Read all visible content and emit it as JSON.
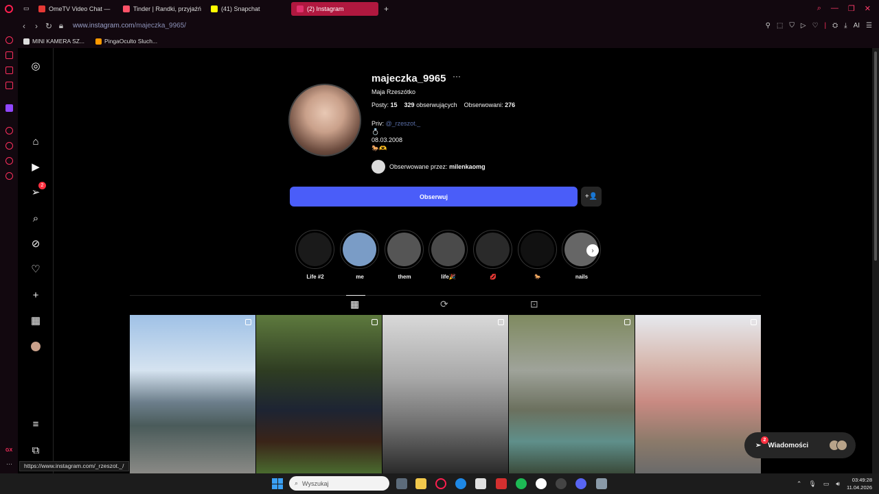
{
  "browser": {
    "tabs": [
      {
        "label": "OmeTV Video Chat —",
        "color": "#e53935"
      },
      {
        "label": "Tinder | Randki, przyjaźń",
        "color": "#fe5268"
      },
      {
        "label": "(41) Snapchat",
        "color": "#fffc00"
      },
      {
        "label": "(2) Instagram",
        "color": "#e1306c"
      }
    ],
    "new_tab": "+",
    "url_host": "www.instagram.com",
    "url_path": "/majeczka_9965/",
    "ai_label": "AI",
    "bookmarks": [
      "MINI KAMERA SZ...",
      "PingaOculto Sluch..."
    ],
    "status_link": "https://www.instagram.com/_rzeszot._/",
    "opera_gx_label": "GX",
    "accent": "#ff1f4f"
  },
  "nav": {
    "messages_badge": "2"
  },
  "profile": {
    "username": "majeczka_9965",
    "more": "···",
    "full_name": "Maja Rzeszótko",
    "stats": {
      "posts_label": "Posty:",
      "posts": "15",
      "followers": "329",
      "followers_label": "obserwujących",
      "following_label": "Obserwowani:",
      "following": "276"
    },
    "bio_prefix": "Priv:",
    "bio_tag": "@_rzeszot._",
    "bio_line2": "💍",
    "bio_line3": "08.03.2008",
    "bio_line4": "🐎🫶",
    "followed_by_prefix": "Obserwowane przez:",
    "followed_by_user": "milenkaomg",
    "follow_button": "Obserwuj",
    "suggest_icon": "+👤"
  },
  "highlights": [
    {
      "label": "Life #2",
      "color": "#1a1a1a"
    },
    {
      "label": "me",
      "color": "#7a9cc6"
    },
    {
      "label": "them",
      "color": "#555555"
    },
    {
      "label": "life🎉",
      "color": "#4a4a4a"
    },
    {
      "label": "💋",
      "color": "#2a2a2a"
    },
    {
      "label": "🐎",
      "color": "#111111"
    },
    {
      "label": "nails",
      "color": "#666666"
    }
  ],
  "highlights_next": "›",
  "posts": [
    {
      "desc": "bridge",
      "bg": "linear-gradient(180deg,#9fc1e6 0%,#d5e3f0 35%,#6d7f8c 55%,#4a5b5a 70%,#8a8a86 100%)"
    },
    {
      "desc": "horse rider",
      "bg": "linear-gradient(180deg,#5e7a3e 0%,#2f3d22 35%,#1d2433 60%,#3a2418 80%,#4a6b2f 100%)"
    },
    {
      "desc": "mirror selfie",
      "bg": "linear-gradient(180deg,#d9d9d9 0%,#a8a8a8 40%,#6e6e6e 70%,#2a2a2a 100%)"
    },
    {
      "desc": "gorge river",
      "bg": "linear-gradient(180deg,#7f8a60 0%,#9fa39a 35%,#6b705e 60%,#5f8f8a 80%,#3a4a3a 100%)"
    },
    {
      "desc": "old town",
      "bg": "linear-gradient(180deg,#e6e9ee 0%,#d7b9b0 30%,#c98a82 55%,#8b7a6a 80%,#6a6a6a 100%)"
    }
  ],
  "messages": {
    "label": "Wiadomości",
    "badge": "2"
  },
  "taskbar": {
    "search_placeholder": "Wyszukaj",
    "time": "03:49:28",
    "date": "11.04.2026"
  }
}
